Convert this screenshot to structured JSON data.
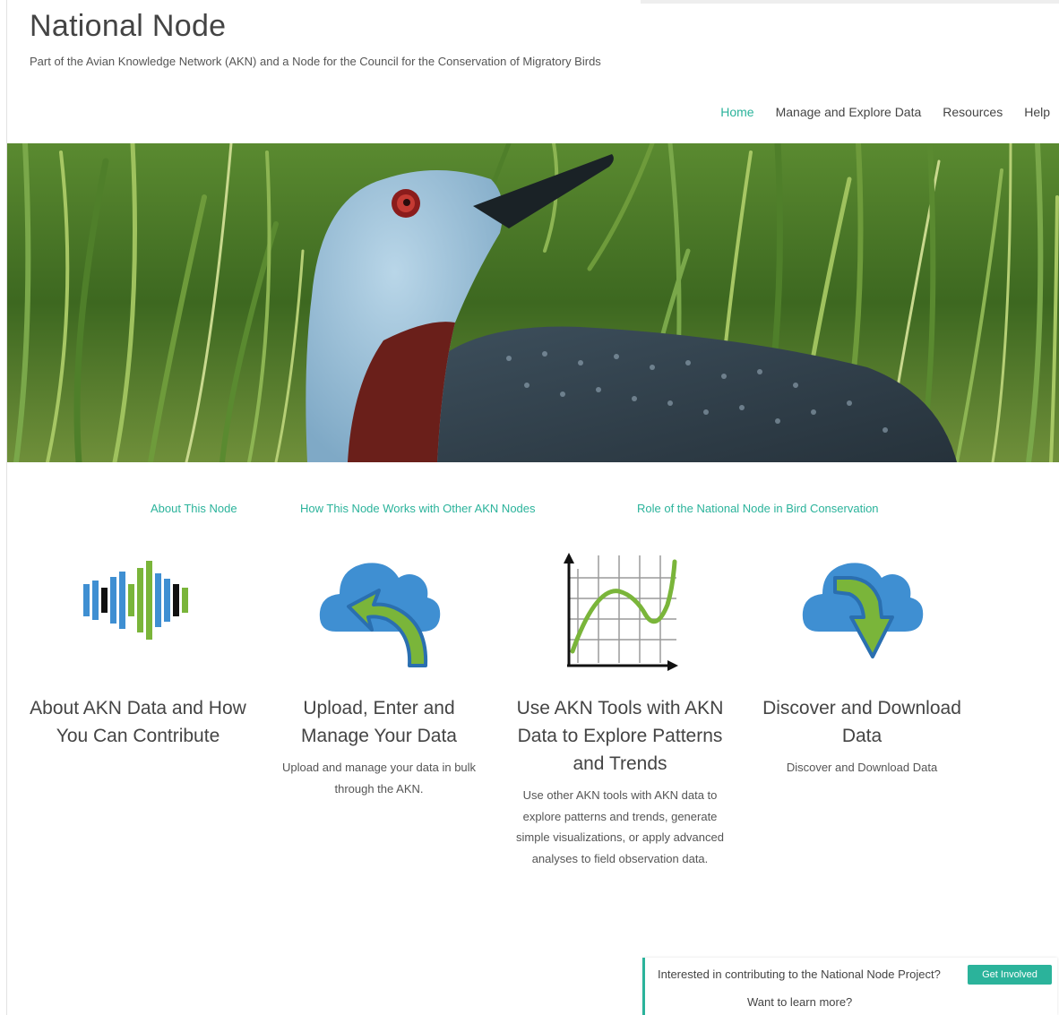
{
  "header": {
    "title": "National Node",
    "tagline": "Part of the Avian Knowledge Network (AKN) and a Node for the Council for the Conservation of Migratory Birds"
  },
  "nav": {
    "items": [
      {
        "label": "Home",
        "active": true
      },
      {
        "label": "Manage and Explore Data",
        "active": false
      },
      {
        "label": "Resources",
        "active": false
      },
      {
        "label": "Help",
        "active": false
      }
    ]
  },
  "hero": {
    "subject": "red-throated-loon-photo"
  },
  "sublinks": [
    {
      "label": "About This Node"
    },
    {
      "label": "How This Node Works with Other AKN Nodes"
    },
    {
      "label": "Role of the National Node in Bird Conservation"
    }
  ],
  "cards": [
    {
      "icon": "data-bars-icon",
      "title": "About AKN Data and How You Can Contribute",
      "description": ""
    },
    {
      "icon": "cloud-upload-icon",
      "title": "Upload, Enter and Manage Your Data",
      "description": "Upload and manage your data in bulk through the AKN."
    },
    {
      "icon": "chart-icon",
      "title": "Use AKN Tools with AKN Data to Explore Patterns and Trends",
      "description": "Use other AKN tools with AKN data to explore patterns and trends, generate simple visualizations, or apply advanced analyses to field observation data."
    },
    {
      "icon": "cloud-download-icon",
      "title": "Discover and Download Data",
      "description": "Discover and Download Data"
    }
  ],
  "cta": {
    "text": "Interested in contributing to the National Node Project?",
    "button": "Get Involved",
    "learn_more": "Want to learn more?"
  },
  "colors": {
    "accent": "#2bb39b",
    "icon_blue": "#3f8fd2",
    "icon_green": "#7ab53a"
  }
}
